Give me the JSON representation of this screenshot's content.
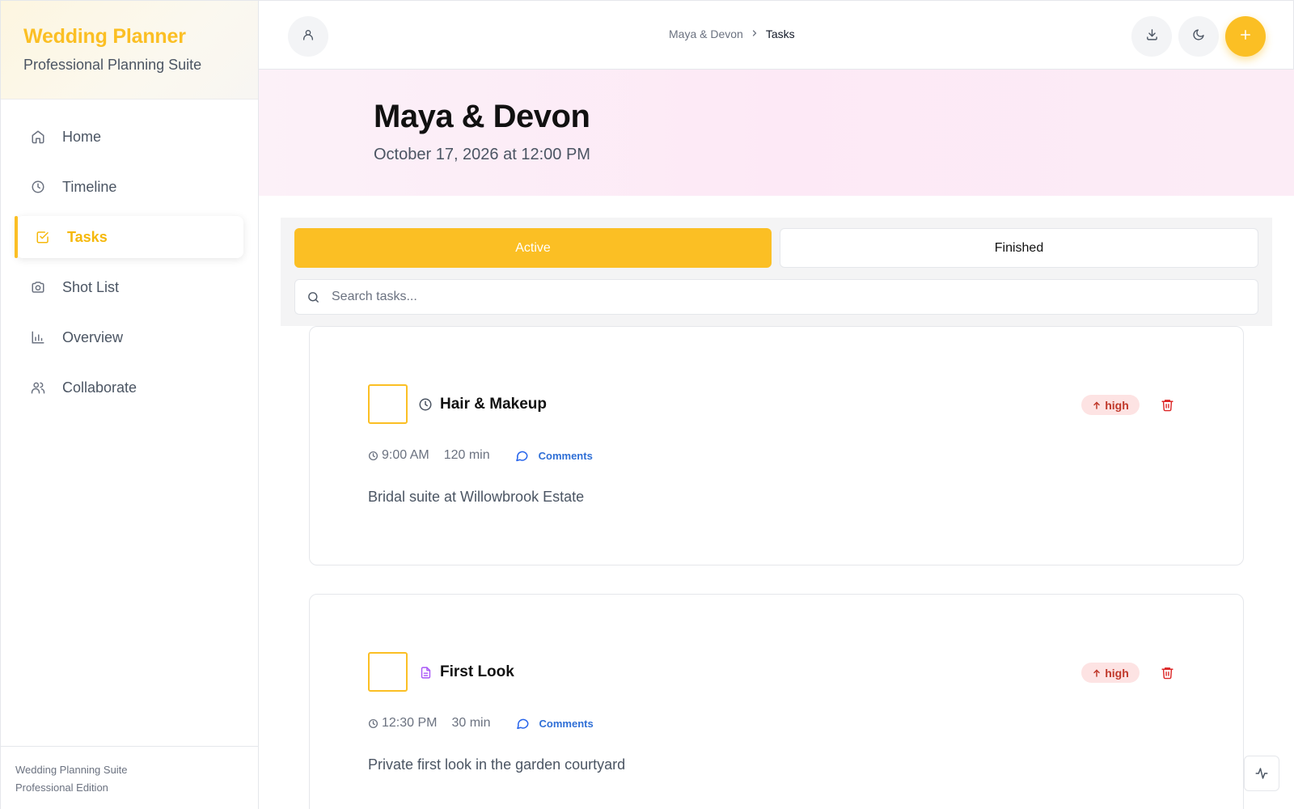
{
  "brand": {
    "title": "Wedding Planner",
    "subtitle": "Professional Planning Suite"
  },
  "nav": [
    {
      "label": "Home",
      "icon": "home-icon"
    },
    {
      "label": "Timeline",
      "icon": "clock-icon"
    },
    {
      "label": "Tasks",
      "icon": "check-square-icon",
      "active": true
    },
    {
      "label": "Shot List",
      "icon": "camera-icon"
    },
    {
      "label": "Overview",
      "icon": "bar-chart-icon"
    },
    {
      "label": "Collaborate",
      "icon": "users-icon"
    }
  ],
  "footer": {
    "line1": "Wedding Planning Suite",
    "line2": "Professional Edition"
  },
  "breadcrumb": {
    "parent": "Maya & Devon",
    "current": "Tasks"
  },
  "hero": {
    "title": "Maya & Devon",
    "date": "October 17, 2026 at 12:00 PM"
  },
  "tabs": {
    "active": "Active",
    "finished": "Finished"
  },
  "search": {
    "placeholder": "Search tasks..."
  },
  "tasks": [
    {
      "title": "Hair & Makeup",
      "type_icon": "clock-icon",
      "priority": "high",
      "time": "9:00 AM",
      "duration": "120 min",
      "comments_label": "Comments",
      "description": "Bridal suite at Willowbrook Estate"
    },
    {
      "title": "First Look",
      "type_icon": "document-icon",
      "priority": "high",
      "time": "12:30 PM",
      "duration": "30 min",
      "comments_label": "Comments",
      "description": "Private first look in the garden courtyard"
    }
  ],
  "colors": {
    "accent": "#fbbf24",
    "priority_high_bg": "#fde3e3",
    "priority_high_text": "#c0392b",
    "link": "#2f6fd6",
    "doc_icon": "#a855f7"
  }
}
